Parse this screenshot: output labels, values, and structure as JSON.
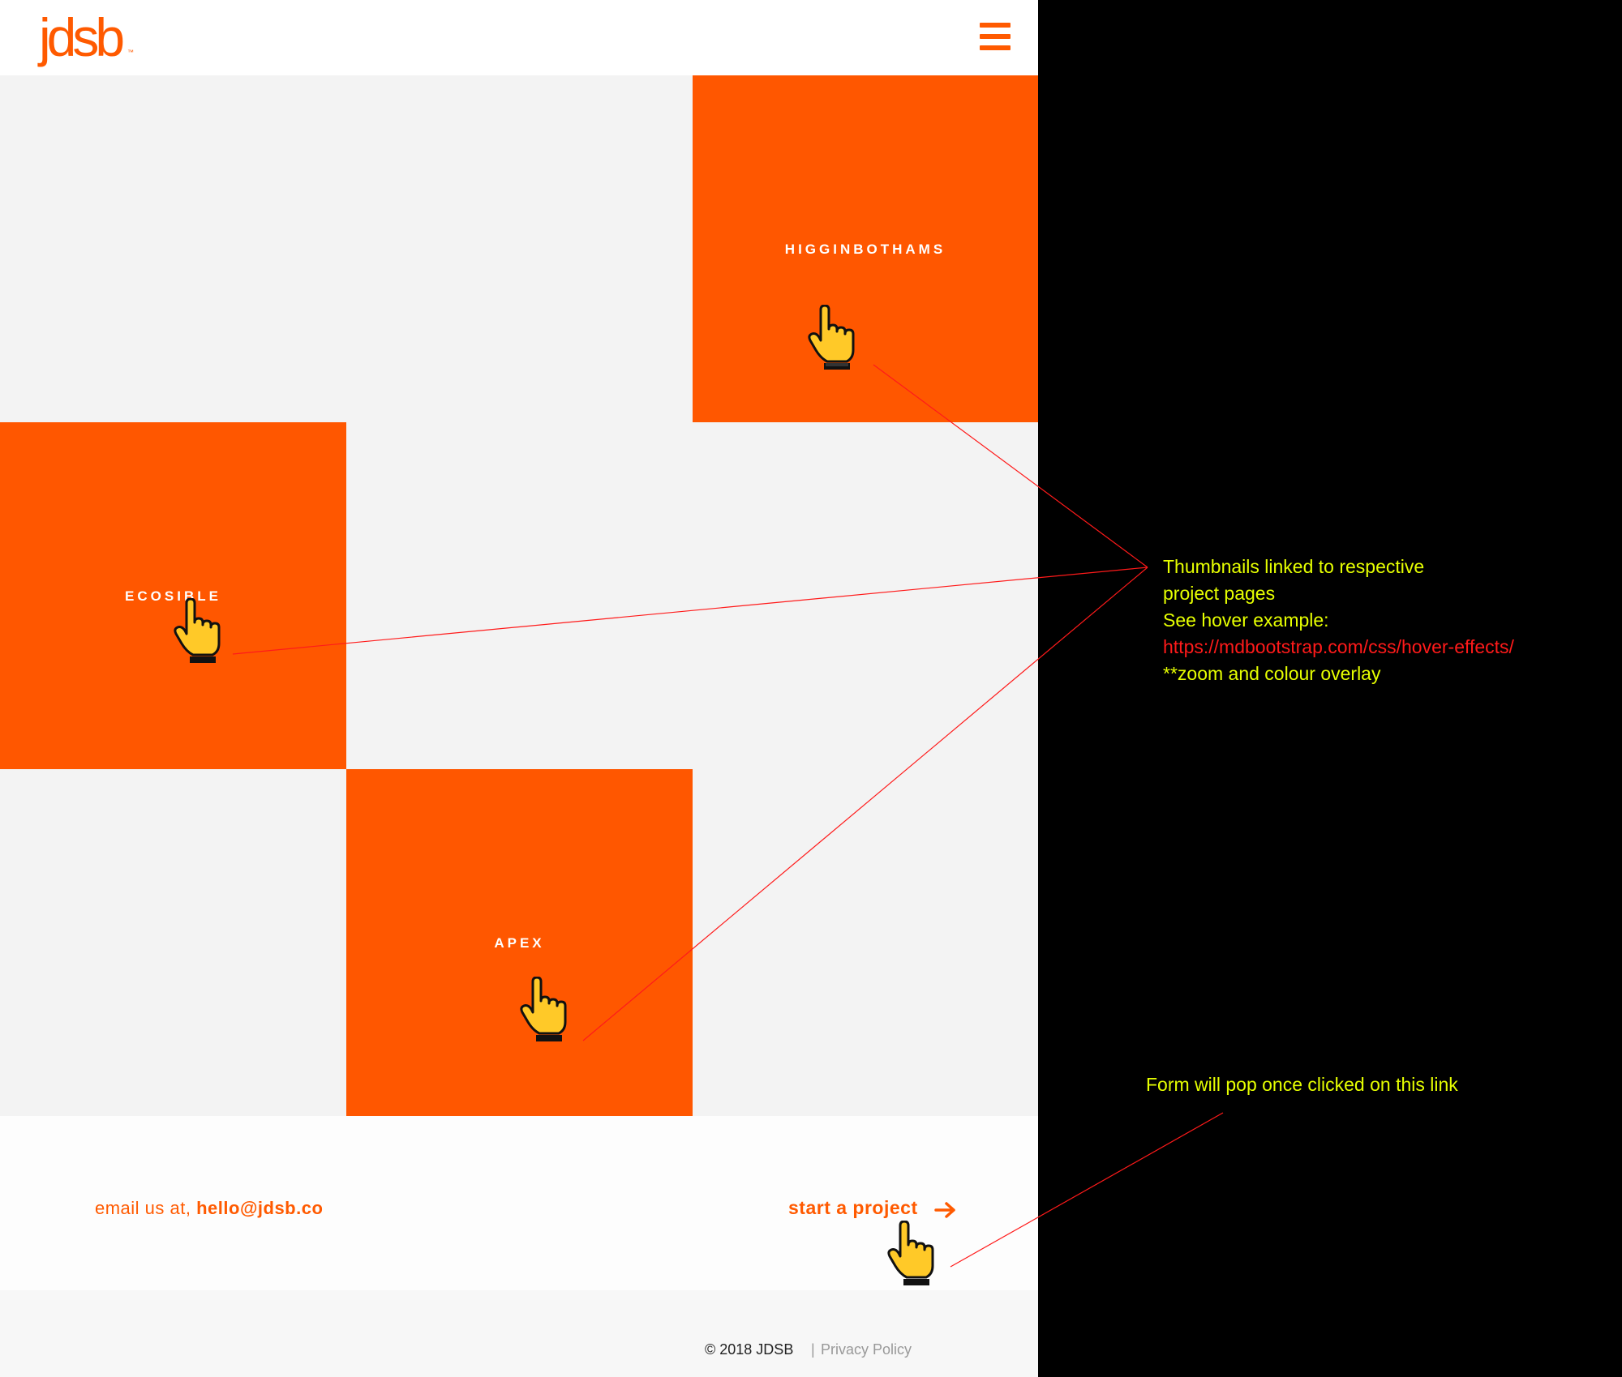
{
  "header": {
    "logo": "jdsb",
    "logo_tm": "™",
    "menu_icon": "hamburger-icon"
  },
  "projects": [
    {
      "label": "HIGGINBOTHAMS"
    },
    {
      "label": "ECOSIBLE"
    },
    {
      "label": "APEX"
    }
  ],
  "contact": {
    "email_prefix": "email us at, ",
    "email": "hello@jdsb.co",
    "cta_label": "start a project",
    "cta_icon": "arrow-right-icon"
  },
  "footer": {
    "copyright": "© 2018 JDSB",
    "separator": "|",
    "privacy": "Privacy Policy"
  },
  "annotations": {
    "thumbnails": {
      "line1": "Thumbnails linked to respective",
      "line2": "project pages",
      "line3": "See hover example:",
      "url": "https://mdbootstrap.com/css/hover-effects/",
      "line5": "**zoom and colour overlay"
    },
    "form": "Form will pop once clicked on this link"
  },
  "colors": {
    "brand": "#ff5700",
    "tile_grey": "#f3f3f3",
    "annotation_text": "#e6ff00",
    "annotation_link": "#ff1a1a",
    "annotation_line": "#ff1a1a",
    "cursor_hand": "#ffc928"
  }
}
